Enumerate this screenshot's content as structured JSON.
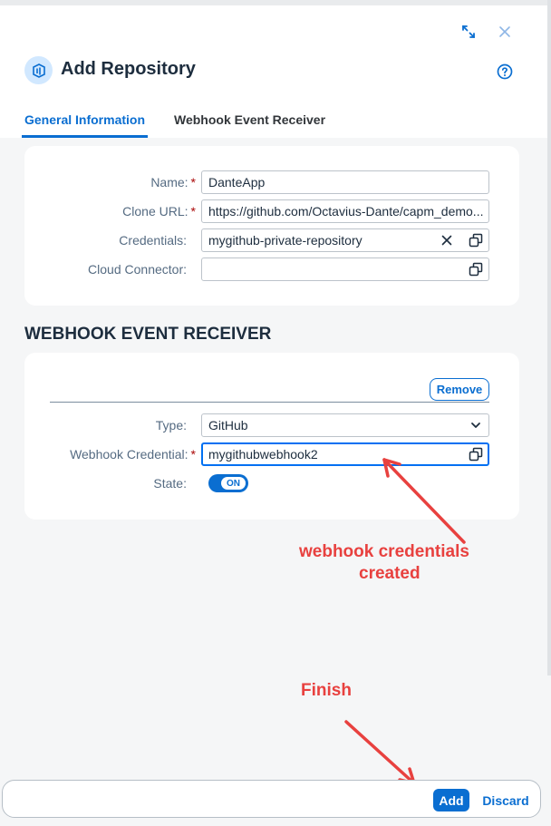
{
  "dialog": {
    "title": "Add Repository",
    "tabs": [
      {
        "label": "General Information",
        "selected": true
      },
      {
        "label": "Webhook Event Receiver",
        "selected": false
      }
    ]
  },
  "general": {
    "name": {
      "label": "Name:",
      "value": "DanteApp",
      "required": true
    },
    "clone_url": {
      "label": "Clone URL:",
      "value": "https://github.com/Octavius-Dante/capm_demo...",
      "required": true
    },
    "credentials": {
      "label": "Credentials:",
      "value": "mygithub-private-repository"
    },
    "cloud_connector": {
      "label": "Cloud Connector:",
      "value": ""
    }
  },
  "webhook": {
    "section_title": "WEBHOOK EVENT RECEIVER",
    "remove_label": "Remove",
    "type": {
      "label": "Type:",
      "value": "GitHub"
    },
    "credential": {
      "label": "Webhook Credential:",
      "value": "mygithubwebhook2",
      "required": true
    },
    "state": {
      "label": "State:",
      "value": "ON"
    }
  },
  "annotations": {
    "webhook_note_line1": "webhook credentials",
    "webhook_note_line2": "created",
    "finish_note": "Finish"
  },
  "footer": {
    "add_label": "Add",
    "discard_label": "Discard"
  },
  "colors": {
    "accent": "#0a6ed1",
    "required_marker": "#aa0808",
    "annotation": "#e8413f"
  },
  "icons": [
    "expand-icon",
    "close-icon",
    "help-icon",
    "repository-icon",
    "clear-icon",
    "value-help-icon",
    "chevron-down-icon"
  ]
}
